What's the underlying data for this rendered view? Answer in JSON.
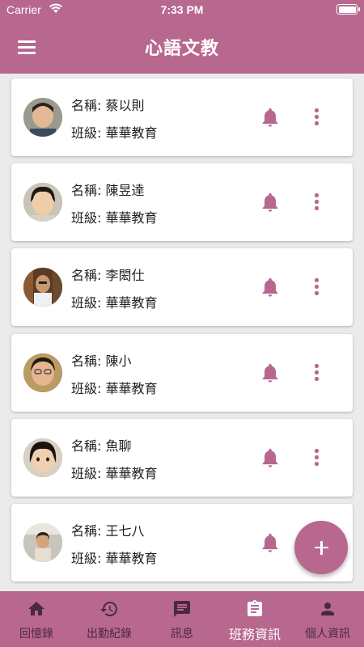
{
  "status_bar": {
    "carrier": "Carrier",
    "time": "7:33 PM"
  },
  "app_bar": {
    "title": "心語文教",
    "menu_icon": "menu-icon"
  },
  "colors": {
    "primary": "#b8678f",
    "background": "#ebebeb",
    "nav_inactive": "#4a2a3a"
  },
  "students": [
    {
      "name": "名稱: 蔡以則",
      "class": "班級: 華華教育"
    },
    {
      "name": "名稱: 陳昱達",
      "class": "班級: 華華教育"
    },
    {
      "name": "名稱: 李閎仕",
      "class": "班級: 華華教育"
    },
    {
      "name": "名稱: 陳小",
      "class": "班級: 華華教育"
    },
    {
      "name": "名稱: 魚聊",
      "class": "班級: 華華教育"
    },
    {
      "name": "名稱: 王七八",
      "class": "班級: 華華教育"
    }
  ],
  "bottom_nav": [
    {
      "label": "回憶錄",
      "icon": "home-icon",
      "active": false
    },
    {
      "label": "出勤紀錄",
      "icon": "history-icon",
      "active": false
    },
    {
      "label": "訊息",
      "icon": "message-icon",
      "active": false
    },
    {
      "label": "班務資訊",
      "icon": "clipboard-icon",
      "active": true
    },
    {
      "label": "個人資訊",
      "icon": "person-icon",
      "active": false
    }
  ],
  "fab": {
    "icon": "plus-icon"
  }
}
